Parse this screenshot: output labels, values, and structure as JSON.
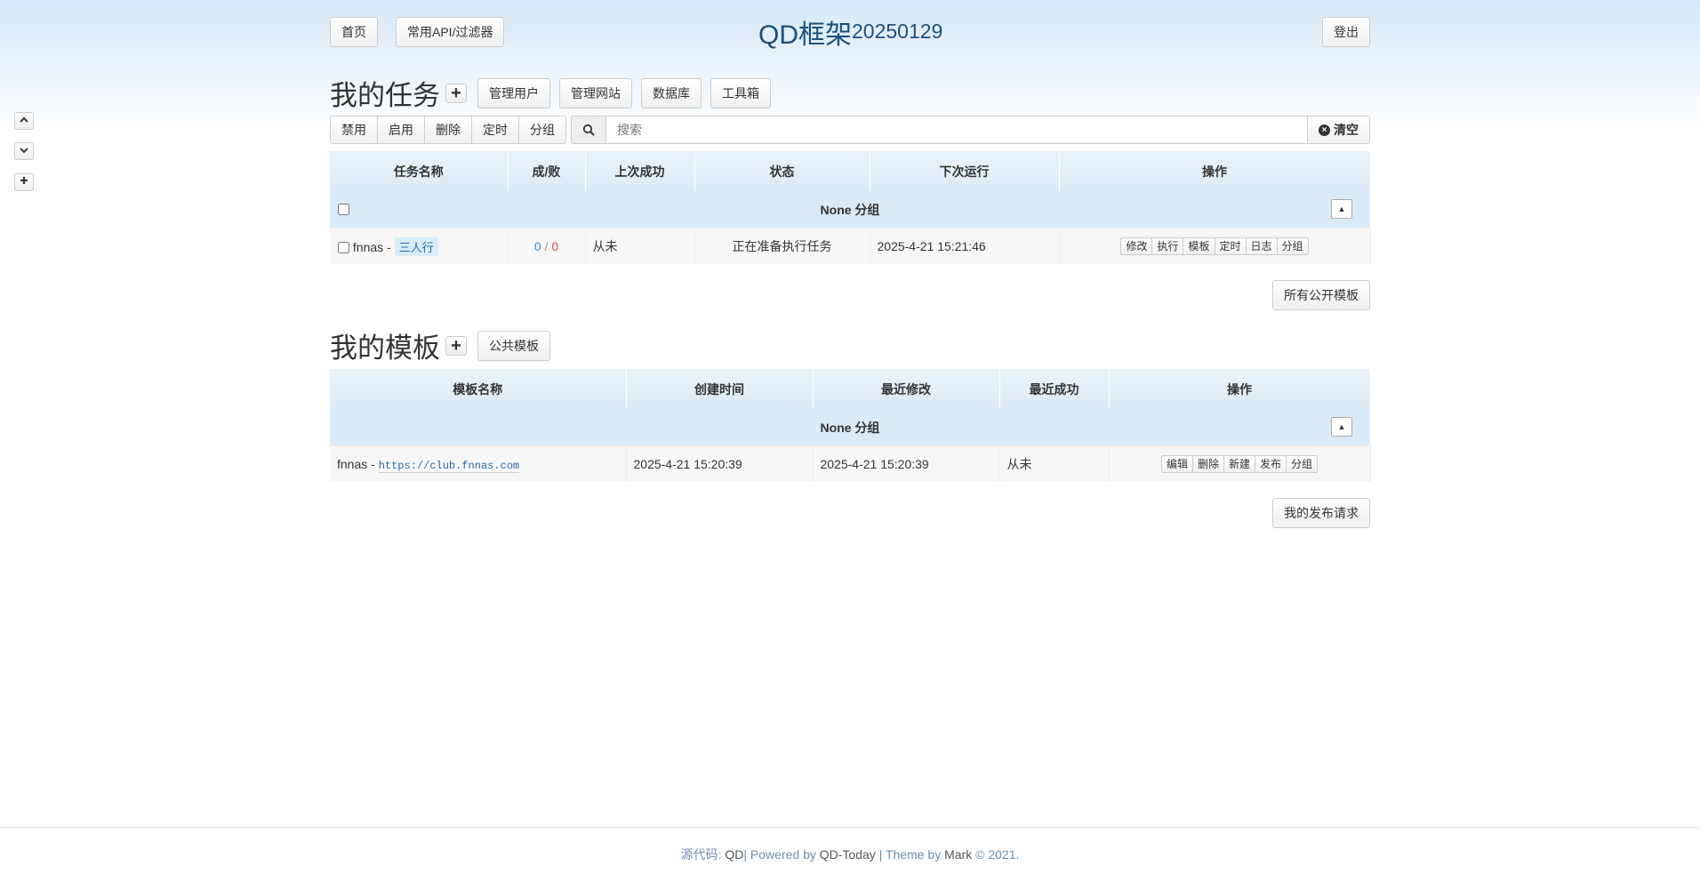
{
  "header": {
    "home_label": "首页",
    "api_label": "常用API/过滤器",
    "brand": "QD框架",
    "version": "20250129",
    "logout_label": "登出"
  },
  "tasks": {
    "title": "我的任务",
    "nav": [
      "管理用户",
      "管理网站",
      "数据库",
      "工具箱"
    ],
    "actions": [
      "禁用",
      "启用",
      "删除",
      "定时",
      "分组"
    ],
    "search_placeholder": "搜索",
    "clear_label": "清空",
    "columns": [
      "任务名称",
      "成/败",
      "上次成功",
      "状态",
      "下次运行",
      "操作"
    ],
    "group_label": "None 分组",
    "rows": [
      {
        "name": "fnnas -",
        "tag": "三人行",
        "success": "0",
        "divider": "/",
        "fail": "0",
        "last_success": "从未",
        "status": "正在准备执行任务",
        "next_run": "2025-4-21 15:21:46",
        "ops": [
          "修改",
          "执行",
          "模板",
          "定时",
          "日志",
          "分组"
        ]
      }
    ],
    "public_templates_label": "所有公开模板"
  },
  "templates": {
    "title": "我的模板",
    "public_label": "公共模板",
    "columns": [
      "模板名称",
      "创建时间",
      "最近修改",
      "最近成功",
      "操作"
    ],
    "group_label": "None 分组",
    "rows": [
      {
        "name": "fnnas -",
        "url": "https://club.fnnas.com",
        "created": "2025-4-21 15:20:39",
        "modified": "2025-4-21 15:20:39",
        "last_success": "从未",
        "ops": [
          "编辑",
          "删除",
          "新建",
          "发布",
          "分组"
        ]
      }
    ],
    "my_requests_label": "我的发布请求"
  },
  "sidebar": {
    "icons": [
      "chevron-up-icon",
      "chevron-down-icon",
      "plus-icon"
    ]
  },
  "footer": {
    "source_label": "源代码:",
    "source_name": "QD",
    "powered_label": "| Powered by",
    "powered_name": "QD-Today",
    "theme_label": "| Theme by",
    "theme_author": "Mark",
    "copyright": "© 2021."
  },
  "colors": {
    "brand": "#1d4f7c",
    "header_bg": "#d9ebf8",
    "link": "#2a6aa6",
    "success": "#3a8fd8",
    "fail": "#d9534f"
  }
}
